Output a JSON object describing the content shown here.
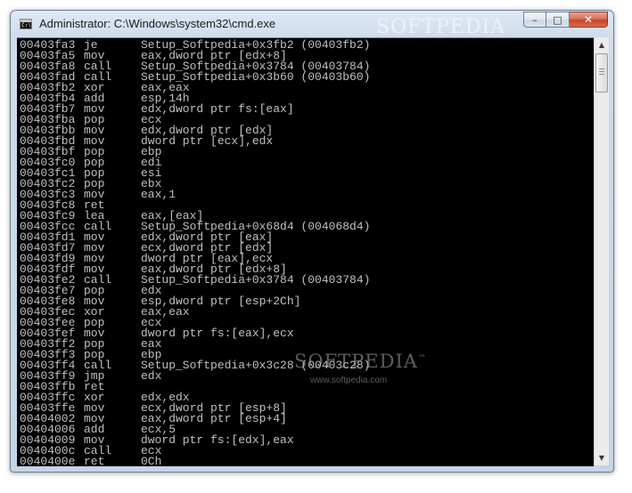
{
  "window": {
    "title": "Administrator: C:\\Windows\\system32\\cmd.exe",
    "icon": "cmd-console-icon",
    "icon_glyph": "C:\\",
    "buttons": {
      "minimize": "–",
      "maximize": "□",
      "close": "✕"
    }
  },
  "watermark": {
    "text": "SOFTPEDIA",
    "url": "www.softpedia.com",
    "trademark": "™"
  },
  "console": {
    "lines": [
      {
        "addr": "00403fa3",
        "mn": "je",
        "op": "Setup_Softpedia+0x3fb2 (00403fb2)"
      },
      {
        "addr": "00403fa5",
        "mn": "mov",
        "op": "eax,dword ptr [edx+8]"
      },
      {
        "addr": "00403fa8",
        "mn": "call",
        "op": "Setup_Softpedia+0x3784 (00403784)"
      },
      {
        "addr": "00403fad",
        "mn": "call",
        "op": "Setup_Softpedia+0x3b60 (00403b60)"
      },
      {
        "addr": "00403fb2",
        "mn": "xor",
        "op": "eax,eax"
      },
      {
        "addr": "00403fb4",
        "mn": "add",
        "op": "esp,14h"
      },
      {
        "addr": "00403fb7",
        "mn": "mov",
        "op": "edx,dword ptr fs:[eax]"
      },
      {
        "addr": "00403fba",
        "mn": "pop",
        "op": "ecx"
      },
      {
        "addr": "00403fbb",
        "mn": "mov",
        "op": "edx,dword ptr [edx]"
      },
      {
        "addr": "00403fbd",
        "mn": "mov",
        "op": "dword ptr [ecx],edx"
      },
      {
        "addr": "00403fbf",
        "mn": "pop",
        "op": "ebp"
      },
      {
        "addr": "00403fc0",
        "mn": "pop",
        "op": "edi"
      },
      {
        "addr": "00403fc1",
        "mn": "pop",
        "op": "esi"
      },
      {
        "addr": "00403fc2",
        "mn": "pop",
        "op": "ebx"
      },
      {
        "addr": "00403fc3",
        "mn": "mov",
        "op": "eax,1"
      },
      {
        "addr": "00403fc8",
        "mn": "ret",
        "op": ""
      },
      {
        "addr": "00403fc9",
        "mn": "lea",
        "op": "eax,[eax]"
      },
      {
        "addr": "00403fcc",
        "mn": "call",
        "op": "Setup_Softpedia+0x68d4 (004068d4)"
      },
      {
        "addr": "00403fd1",
        "mn": "mov",
        "op": "edx,dword ptr [eax]"
      },
      {
        "addr": "00403fd7",
        "mn": "mov",
        "op": "ecx,dword ptr [edx]"
      },
      {
        "addr": "00403fd9",
        "mn": "mov",
        "op": "dword ptr [eax],ecx"
      },
      {
        "addr": "00403fdf",
        "mn": "mov",
        "op": "eax,dword ptr [edx+8]"
      },
      {
        "addr": "00403fe2",
        "mn": "call",
        "op": "Setup_Softpedia+0x3784 (00403784)"
      },
      {
        "addr": "00403fe7",
        "mn": "pop",
        "op": "edx"
      },
      {
        "addr": "00403fe8",
        "mn": "mov",
        "op": "esp,dword ptr [esp+2Ch]"
      },
      {
        "addr": "00403fec",
        "mn": "xor",
        "op": "eax,eax"
      },
      {
        "addr": "00403fee",
        "mn": "pop",
        "op": "ecx"
      },
      {
        "addr": "00403fef",
        "mn": "mov",
        "op": "dword ptr fs:[eax],ecx"
      },
      {
        "addr": "00403ff2",
        "mn": "pop",
        "op": "eax"
      },
      {
        "addr": "00403ff3",
        "mn": "pop",
        "op": "ebp"
      },
      {
        "addr": "00403ff4",
        "mn": "call",
        "op": "Setup_Softpedia+0x3c28 (00403c28)"
      },
      {
        "addr": "00403ff9",
        "mn": "jmp",
        "op": "edx"
      },
      {
        "addr": "00403ffb",
        "mn": "ret",
        "op": ""
      },
      {
        "addr": "00403ffc",
        "mn": "xor",
        "op": "edx,edx"
      },
      {
        "addr": "00403ffe",
        "mn": "mov",
        "op": "ecx,dword ptr [esp+8]"
      },
      {
        "addr": "00404002",
        "mn": "mov",
        "op": "eax,dword ptr [esp+4]"
      },
      {
        "addr": "00404006",
        "mn": "add",
        "op": "ecx,5"
      },
      {
        "addr": "00404009",
        "mn": "mov",
        "op": "dword ptr fs:[edx],eax"
      },
      {
        "addr": "0040400c",
        "mn": "call",
        "op": "ecx"
      },
      {
        "addr": "0040400e",
        "mn": "ret",
        "op": "0Ch"
      }
    ]
  },
  "scrollbar": {
    "up_arrow": "▲",
    "down_arrow": "▼"
  },
  "colors": {
    "console_bg": "#000000",
    "console_fg": "#c0c0c0",
    "close_button": "#c7452c"
  }
}
